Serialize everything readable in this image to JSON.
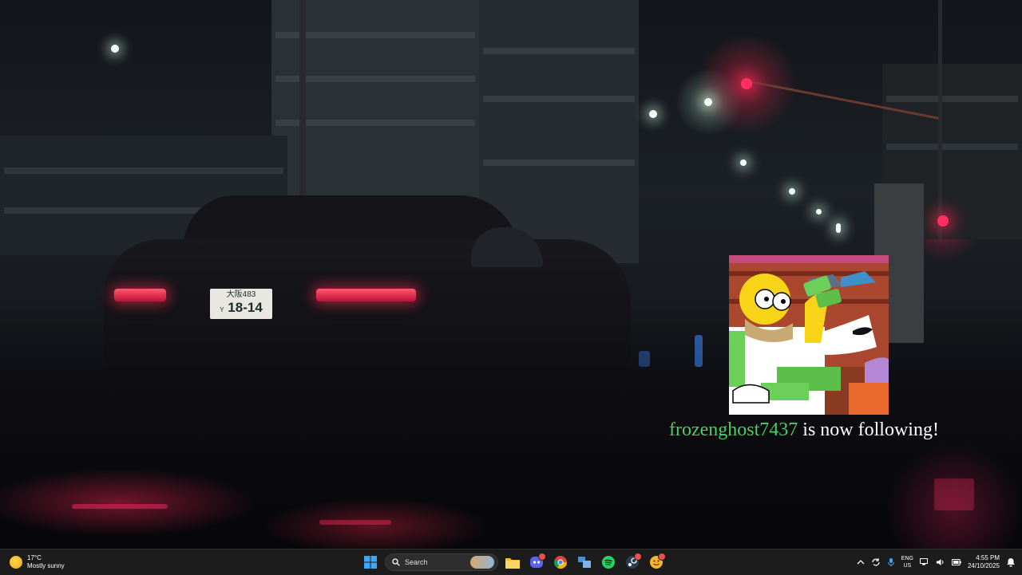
{
  "overlay": {
    "username": "frozenghost7437",
    "message": "is now following!",
    "username_color": "#46d160"
  },
  "car": {
    "plate_line1": "大阪483",
    "plate_line2": "18-14",
    "plate_prefix": "Y"
  },
  "taskbar": {
    "weather_temp": "17°C",
    "weather_desc": "Mostly sunny",
    "weather_icon": "partly-sunny-icon",
    "search_label": "Search",
    "apps": [
      {
        "name": "start-button",
        "icon": "windows-logo-icon"
      },
      {
        "name": "file-explorer",
        "icon": "folder-icon"
      },
      {
        "name": "discord",
        "icon": "discord-icon",
        "badge": true
      },
      {
        "name": "chrome",
        "icon": "chrome-icon"
      },
      {
        "name": "task-view",
        "icon": "task-view-icon"
      },
      {
        "name": "spotify",
        "icon": "spotify-icon"
      },
      {
        "name": "steam",
        "icon": "steam-icon",
        "badge": true
      },
      {
        "name": "app",
        "icon": "smiley-icon",
        "badge": true
      }
    ],
    "language": "ENG",
    "region": "US",
    "time": "4:55 PM",
    "date": "24/10/2025"
  }
}
